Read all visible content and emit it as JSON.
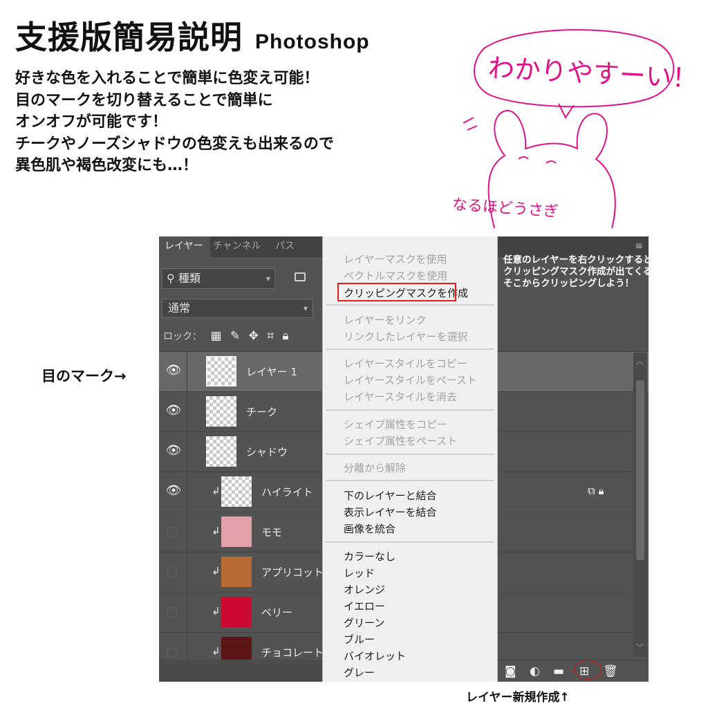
{
  "header": {
    "title": "支援版簡易説明",
    "title_sub": "Photoshop",
    "lines": [
      "好きな色を入れることで簡単に色変え可能！",
      "目のマークを切り替えることで簡単に",
      "オンオフが可能です！",
      "チークやノーズシャドウの色変えも出来るので",
      "異色肌や褐色改変にも…！"
    ]
  },
  "doodle": {
    "bubble": "わかりやすーい！",
    "bunny": "なるほどうさぎ"
  },
  "annotations": {
    "eye_mark": "目のマーク→",
    "new_layer": "レイヤー新規作成↑",
    "right_click_info": [
      "任意のレイヤーを右クリックすると",
      "クリッピングマスク作成が出てくるので",
      "そこからクリッピングしよう！"
    ]
  },
  "panel": {
    "tabs": [
      "レイヤー",
      "チャンネル",
      "パス"
    ],
    "filter_label": "種類",
    "blend_mode": "通常",
    "lock_label": "ロック：",
    "layers": [
      {
        "name": "レイヤー 1",
        "visible": true,
        "clipped": false,
        "thumb": "transparent",
        "selected": true
      },
      {
        "name": "チーク",
        "visible": true,
        "clipped": false,
        "thumb": "transparent",
        "selected": false
      },
      {
        "name": "シャドウ",
        "visible": true,
        "clipped": false,
        "thumb": "transparent",
        "selected": false
      },
      {
        "name": "ハイライト",
        "visible": true,
        "clipped": true,
        "thumb": "transparent",
        "selected": false
      },
      {
        "name": "モモ",
        "visible": false,
        "clipped": true,
        "thumb": "#e2a1a8",
        "selected": false
      },
      {
        "name": "アプリコット",
        "visible": false,
        "clipped": true,
        "thumb": "#b86c34",
        "selected": false
      },
      {
        "name": "ベリー",
        "visible": false,
        "clipped": true,
        "thumb": "#cd0a32",
        "selected": false
      },
      {
        "name": "チョコレート",
        "visible": false,
        "clipped": true,
        "thumb": "#5e1515",
        "selected": false
      }
    ]
  },
  "context_menu": {
    "items": [
      {
        "label": "レイヤーマスクを使用",
        "enabled": false
      },
      {
        "label": "ベクトルマスクを使用",
        "enabled": false
      },
      {
        "label": "クリッピングマスクを作成",
        "enabled": true
      },
      {
        "label": "レイヤーをリンク",
        "enabled": false
      },
      {
        "label": "リンクしたレイヤーを選択",
        "enabled": false
      },
      {
        "label": "レイヤースタイルをコピー",
        "enabled": false
      },
      {
        "label": "レイヤースタイルをペースト",
        "enabled": false
      },
      {
        "label": "レイヤースタイルを消去",
        "enabled": false
      },
      {
        "label": "シェイプ属性をコピー",
        "enabled": false
      },
      {
        "label": "シェイプ属性をペースト",
        "enabled": false
      },
      {
        "label": "分離から解除",
        "enabled": false
      },
      {
        "label": "下のレイヤーと結合",
        "enabled": true
      },
      {
        "label": "表示レイヤーを結合",
        "enabled": true
      },
      {
        "label": "画像を統合",
        "enabled": true
      },
      {
        "label": "カラーなし",
        "enabled": true
      },
      {
        "label": "レッド",
        "enabled": true
      },
      {
        "label": "オレンジ",
        "enabled": true
      },
      {
        "label": "イエロー",
        "enabled": true
      },
      {
        "label": "グリーン",
        "enabled": true
      },
      {
        "label": "ブルー",
        "enabled": true
      },
      {
        "label": "バイオレット",
        "enabled": true
      },
      {
        "label": "グレー",
        "enabled": true
      }
    ]
  },
  "icons": {
    "search": "search-icon",
    "eye": "eye-icon",
    "clip": "clipping-arrow-icon",
    "new_layer": "new-layer-icon",
    "trash": "trash-icon"
  },
  "colors": {
    "accent_pink": "#e0128a",
    "highlight_red": "#e21b1b",
    "panel_bg": "#535353"
  }
}
